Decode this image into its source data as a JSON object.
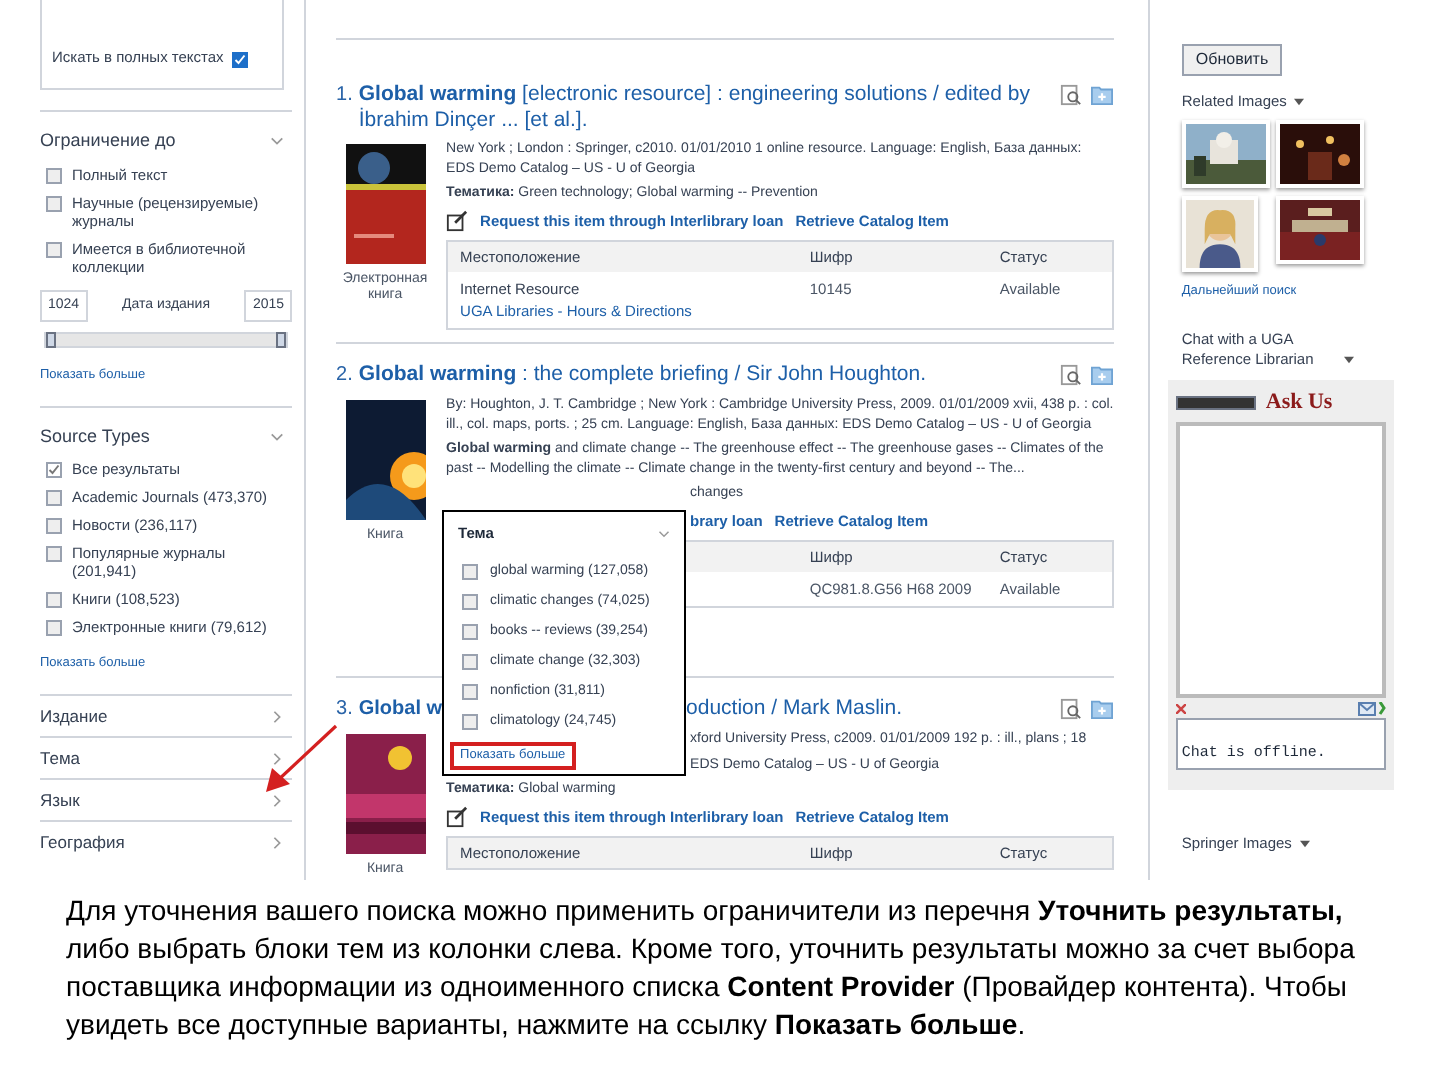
{
  "sidebar": {
    "fulltext_option": {
      "label": "Искать в полных текстах",
      "checked": true
    },
    "facets": [
      {
        "title": "Ограничение до",
        "expanded": true,
        "options": [
          {
            "label": "Полный текст",
            "checked": false
          },
          {
            "label": "Научные (рецензируемые) журналы",
            "checked": false
          },
          {
            "label": "Имеется в библиотечной коллекции",
            "checked": false
          }
        ],
        "date_range": {
          "from": "1024",
          "label": "Дата издания",
          "to": "2015",
          "level": 1
        },
        "show_more": "Показать больше"
      },
      {
        "title": "Source Types",
        "expanded": true,
        "options": [
          {
            "label": "Все результаты",
            "checked": true
          },
          {
            "label": "Academic Journals (473,370)",
            "checked": false
          },
          {
            "label": "Новости (236,117)",
            "checked": false
          },
          {
            "label": "Популярные журналы (201,941)",
            "checked": false
          },
          {
            "label": "Книги (108,523)",
            "checked": false
          },
          {
            "label": "Электронные книги (79,612)",
            "checked": false
          }
        ],
        "show_more": "Показать больше"
      }
    ],
    "sections": [
      {
        "title": "Издание",
        "expanded": false
      },
      {
        "title": "Тема",
        "expanded": false
      },
      {
        "title": "Язык",
        "expanded": false
      },
      {
        "title": "География",
        "expanded": false
      }
    ]
  },
  "results": [
    {
      "number": "1.",
      "title": "**Global warming** [electronic resource] : engineering solutions / edited by İbrahim Dinçer ... [et al.].",
      "format": "Электронная книга",
      "lines": [
        {
          "kind": "meta",
          "text": "New York ; London : Springer, c2010. 01/01/2010 1 online resource. Language: English, База данных: EDS Demo Catalog – US - U of Georgia",
          "under_popup": false
        },
        {
          "kind": "subjects",
          "text": "**Тематика:** Green technology; Global warming -- Prevention",
          "under_popup": false
        },
        {
          "kind": "links",
          "links": [
            "Request this item through Interlibrary loan",
            "Retrieve Catalog Item"
          ],
          "under_popup": false
        }
      ],
      "table": {
        "under_popup": false,
        "columns": [
          "Местоположение",
          "Шифр",
          "Статус"
        ],
        "rows": [
          {
            "location": "Internet Resource",
            "location_link": "UGA Libraries - Hours & Directions",
            "call_number": "10145",
            "status": "Available"
          }
        ]
      }
    },
    {
      "number": "2.",
      "title": "**Global warming** : the complete briefing / Sir John Houghton.",
      "format": "Книга",
      "lines": [
        {
          "kind": "meta",
          "text": "By: Houghton, J. T. Cambridge ; New York : Cambridge University Press, 2009. 01/01/2009 xvii, 438 p. : col. ill., col. maps, ports. ; 25 cm. Language: English, База данных: EDS Demo Catalog – US - U of Georgia",
          "under_popup": false
        },
        {
          "kind": "meta",
          "text": "**Global warming** and climate change -- The greenhouse effect -- The greenhouse gases -- Climates of the past -- Modelling the climate -- Climate change in the twenty-first century and beyond -- The...",
          "under_popup": false
        },
        {
          "kind": "subjects",
          "text": "changes",
          "under_popup": true
        },
        {
          "kind": "links",
          "links": [
            "brary loan",
            "Retrieve Catalog Item"
          ],
          "under_popup": true
        }
      ],
      "table": {
        "under_popup": true,
        "columns": [
          "Шифр",
          "Статус"
        ],
        "rows": [
          {
            "call_number": "QC981.8.G56 H68 2009",
            "status": "Available"
          }
        ]
      }
    },
    {
      "number": "3.",
      "title": "**Global w**",
      "title_after_popup": "oduction / Mark Maslin.",
      "format": "Книга",
      "lines": [
        {
          "kind": "meta",
          "text": "xford University Press, c2009. 01/01/2009 192 p. : ill., plans ; 18",
          "under_popup": true
        },
        {
          "kind": "meta",
          "text": "EDS Demo Catalog – US - U of Georgia",
          "under_popup": true
        },
        {
          "kind": "subjects",
          "text": "**Тематика:** Global warming",
          "under_popup": false
        },
        {
          "kind": "links",
          "links": [
            "Request this item through Interlibrary loan",
            "Retrieve Catalog Item"
          ],
          "under_popup": false
        }
      ],
      "table": {
        "under_popup": false,
        "columns": [
          "Местоположение",
          "Шифр",
          "Статус"
        ]
      }
    }
  ],
  "subject_popup": {
    "title": "Тема",
    "options": [
      {
        "label": "global warming (127,058)",
        "checked": false
      },
      {
        "label": "climatic changes (74,025)",
        "checked": false
      },
      {
        "label": "books -- reviews (39,254)",
        "checked": false
      },
      {
        "label": "climate change (32,303)",
        "checked": false
      },
      {
        "label": "nonfiction (31,811)",
        "checked": false
      },
      {
        "label": "climatology (24,745)",
        "checked": false
      }
    ],
    "show_more": "Показать больше"
  },
  "right_panel": {
    "update_button": "Обновить",
    "related_images": {
      "title": "Related Images",
      "more_link": "Дальнейший поиск"
    },
    "chat": {
      "title": "Chat with a UGA Reference Librarian",
      "brand": "Ask Us",
      "status": "Chat is offline."
    },
    "springer": {
      "title": "Springer Images"
    }
  },
  "caption": "Для уточнения вашего поиска можно применить ограничители из перечня **Уточнить результаты,** либо выбрать блоки тем из колонки слева. Кроме того, уточнить результаты можно за счет выбора поставщика информации из одноименного списка **Content Provider** (Провайдер контента). Чтобы увидеть все доступные варианты, нажмите на ссылку **Показать больше**."
}
